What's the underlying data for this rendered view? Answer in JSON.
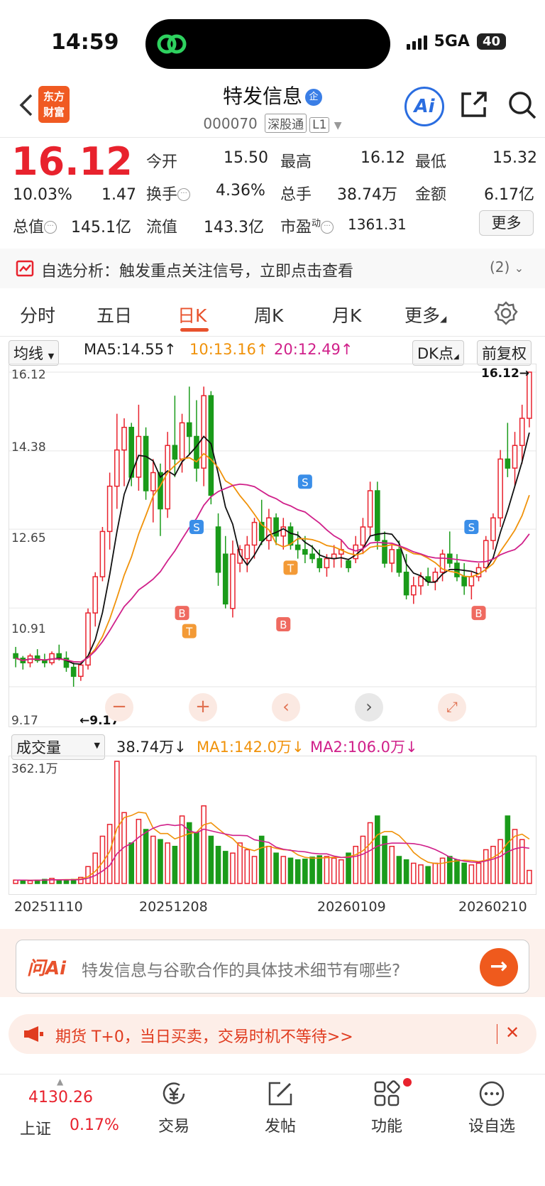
{
  "status_bar": {
    "time": "14:59",
    "network": "5GA",
    "battery": "40"
  },
  "header": {
    "logo_line1": "东方",
    "logo_line2": "财富",
    "name": "特发信息",
    "name_badge": "企",
    "code": "000070",
    "tag1": "深股通",
    "tag2": "L1",
    "ai_label": "Ai"
  },
  "quote": {
    "price": "16.12",
    "change_pct": "10.03%",
    "change": "1.47",
    "open_label": "今开",
    "open": "15.50",
    "high_label": "最高",
    "high": "16.12",
    "low_label": "最低",
    "low": "15.32",
    "turnover_label": "换手",
    "turnover": "4.36%",
    "volume_label": "总手",
    "volume": "38.74万",
    "amount_label": "金额",
    "amount": "6.17亿",
    "mktcap_label": "总值",
    "mktcap": "145.1亿",
    "float_label": "流值",
    "float": "143.3亿",
    "pe_label": "市盈",
    "pe_sup": "动",
    "pe": "1361.31",
    "more_label": "更多"
  },
  "banner": {
    "text": "自选分析：触发重点关注信号，立即点击查看",
    "count": "(2)"
  },
  "tabs": [
    "分时",
    "五日",
    "日K",
    "周K",
    "月K",
    "更多"
  ],
  "active_tab": "日K",
  "ma_bar": {
    "select": "均线",
    "ma5": "MA5:14.55",
    "ma10": "10:13.16",
    "ma20": "20:12.49",
    "dk": "DK点",
    "adjust": "前复权"
  },
  "colors": {
    "up": "#e8222d",
    "down": "#1a9b1a",
    "ma5": "#111111",
    "ma10": "#f0920a",
    "ma20": "#d0208a"
  },
  "kline_axis": {
    "labels": [
      "16.12",
      "14.38",
      "12.65",
      "10.91",
      "9.17"
    ],
    "last_price_marker": "16.12→",
    "low_marker": "←9.17"
  },
  "signals": {
    "buy": "B",
    "sell": "S",
    "t": "T"
  },
  "volume_bar": {
    "select": "成交量",
    "vol": "38.74万",
    "ma1": "MA1:142.0万",
    "ma2": "MA2:106.0万",
    "axis_max": "362.1万"
  },
  "dates": [
    "20251110",
    "20251208",
    "20260109",
    "20260210"
  ],
  "chart_data": {
    "type": "candlestick",
    "ylim": [
      9.17,
      16.12
    ],
    "candles": [
      [
        9.9,
        10.05,
        9.6,
        9.8
      ],
      [
        9.8,
        9.85,
        9.55,
        9.7
      ],
      [
        9.7,
        9.9,
        9.6,
        9.85
      ],
      [
        9.85,
        10.0,
        9.7,
        9.75
      ],
      [
        9.75,
        9.9,
        9.6,
        9.7
      ],
      [
        9.7,
        9.95,
        9.65,
        9.9
      ],
      [
        9.9,
        10.1,
        9.75,
        9.8
      ],
      [
        9.8,
        9.95,
        9.5,
        9.6
      ],
      [
        9.6,
        9.7,
        9.17,
        9.4
      ],
      [
        9.4,
        9.7,
        9.3,
        9.65
      ],
      [
        9.65,
        10.9,
        9.55,
        10.8
      ],
      [
        10.8,
        11.7,
        10.5,
        11.6
      ],
      [
        11.6,
        12.7,
        11.5,
        12.6
      ],
      [
        12.6,
        13.9,
        12.2,
        13.6
      ],
      [
        13.6,
        15.2,
        13.1,
        14.4
      ],
      [
        14.4,
        15.1,
        13.6,
        14.9
      ],
      [
        14.9,
        15.0,
        13.6,
        13.8
      ],
      [
        13.8,
        15.4,
        13.5,
        14.7
      ],
      [
        14.7,
        14.9,
        13.3,
        13.5
      ],
      [
        13.5,
        14.2,
        12.8,
        13.9
      ],
      [
        13.9,
        14.1,
        12.5,
        13.1
      ],
      [
        13.1,
        14.8,
        12.9,
        14.5
      ],
      [
        14.5,
        15.6,
        13.8,
        14.2
      ],
      [
        14.2,
        15.2,
        13.9,
        15.0
      ],
      [
        15.0,
        15.8,
        14.3,
        14.7
      ],
      [
        14.7,
        15.5,
        13.7,
        14.0
      ],
      [
        14.0,
        15.8,
        13.6,
        15.6
      ],
      [
        15.6,
        15.7,
        13.2,
        13.4
      ],
      [
        12.7,
        13.0,
        11.4,
        11.7
      ],
      [
        12.1,
        12.5,
        10.9,
        11.0
      ],
      [
        10.9,
        12.4,
        10.7,
        12.1
      ],
      [
        11.9,
        12.3,
        11.7,
        12.2
      ],
      [
        12.0,
        12.5,
        11.7,
        12.3
      ],
      [
        12.3,
        12.9,
        12.0,
        12.8
      ],
      [
        12.8,
        13.3,
        12.3,
        12.4
      ],
      [
        12.4,
        13.1,
        12.2,
        12.9
      ],
      [
        12.9,
        13.0,
        12.3,
        12.5
      ],
      [
        12.5,
        12.9,
        12.2,
        12.7
      ],
      [
        12.7,
        12.8,
        12.2,
        12.3
      ],
      [
        12.3,
        12.6,
        12.0,
        12.2
      ],
      [
        12.2,
        12.5,
        11.9,
        12.1
      ],
      [
        12.1,
        12.3,
        11.9,
        12.0
      ],
      [
        12.0,
        12.2,
        11.7,
        11.8
      ],
      [
        11.8,
        12.1,
        11.6,
        12.0
      ],
      [
        12.0,
        12.3,
        11.8,
        12.1
      ],
      [
        12.1,
        12.4,
        11.8,
        12.2
      ],
      [
        11.95,
        12.0,
        11.7,
        11.8
      ],
      [
        12.0,
        12.5,
        11.9,
        12.3
      ],
      [
        12.3,
        12.9,
        12.1,
        12.7
      ],
      [
        12.7,
        13.7,
        12.5,
        13.5
      ],
      [
        13.5,
        13.7,
        12.2,
        12.4
      ],
      [
        12.4,
        12.6,
        11.8,
        11.9
      ],
      [
        11.9,
        12.3,
        11.7,
        12.2
      ],
      [
        12.2,
        12.4,
        11.6,
        11.7
      ],
      [
        11.7,
        12.1,
        11.1,
        11.2
      ],
      [
        11.2,
        11.6,
        11.0,
        11.4
      ],
      [
        11.4,
        11.7,
        11.2,
        11.6
      ],
      [
        11.6,
        11.8,
        11.4,
        11.5
      ],
      [
        11.5,
        11.8,
        11.3,
        11.7
      ],
      [
        11.7,
        12.2,
        11.5,
        12.1
      ],
      [
        12.1,
        12.6,
        11.8,
        11.9
      ],
      [
        11.9,
        12.1,
        11.5,
        11.6
      ],
      [
        11.6,
        11.9,
        11.2,
        11.4
      ],
      [
        11.4,
        11.7,
        11.1,
        11.6
      ],
      [
        11.6,
        11.9,
        11.5,
        11.8
      ],
      [
        11.8,
        12.5,
        11.7,
        12.4
      ],
      [
        12.4,
        13.0,
        12.2,
        12.9
      ],
      [
        12.9,
        14.4,
        12.7,
        14.2
      ],
      [
        14.2,
        15.0,
        13.8,
        14.0
      ],
      [
        14.0,
        14.8,
        13.6,
        14.5
      ],
      [
        14.5,
        15.4,
        14.1,
        15.1
      ],
      [
        15.1,
        16.12,
        14.9,
        16.12
      ]
    ],
    "volume": [
      10,
      10,
      8,
      10,
      12,
      15,
      10,
      10,
      12,
      18,
      50,
      90,
      140,
      175,
      362,
      210,
      120,
      190,
      160,
      140,
      130,
      120,
      110,
      200,
      180,
      150,
      230,
      140,
      110,
      95,
      90,
      120,
      100,
      80,
      140,
      110,
      90,
      80,
      75,
      70,
      72,
      78,
      82,
      80,
      75,
      70,
      90,
      110,
      140,
      180,
      200,
      140,
      110,
      80,
      70,
      60,
      55,
      50,
      60,
      75,
      80,
      70,
      60,
      55,
      60,
      100,
      110,
      130,
      200,
      160,
      130,
      38.74
    ],
    "volume_up": [
      1,
      0,
      1,
      0,
      0,
      1,
      0,
      0,
      0,
      1,
      1,
      1,
      1,
      1,
      1,
      1,
      0,
      1,
      0,
      1,
      0,
      1,
      0,
      1,
      0,
      0,
      1,
      0,
      0,
      0,
      1,
      1,
      1,
      1,
      0,
      1,
      0,
      1,
      0,
      0,
      0,
      0,
      0,
      1,
      1,
      1,
      0,
      1,
      1,
      1,
      0,
      0,
      1,
      0,
      0,
      1,
      1,
      0,
      1,
      1,
      0,
      0,
      0,
      1,
      1,
      1,
      1,
      1,
      0,
      1,
      1,
      1
    ]
  },
  "ask_ai": {
    "logo": "问Ai",
    "text": "特发信息与谷歌合作的具体技术细节有哪些?"
  },
  "promo": {
    "text": "期货 T+0，当日买卖，交易时机不等待>>"
  },
  "bottom_nav": {
    "index_value": "4130.26",
    "index_name": "上证",
    "index_change": "0.17%",
    "trade": "交易",
    "post": "发帖",
    "function": "功能",
    "watchlist": "设自选"
  }
}
